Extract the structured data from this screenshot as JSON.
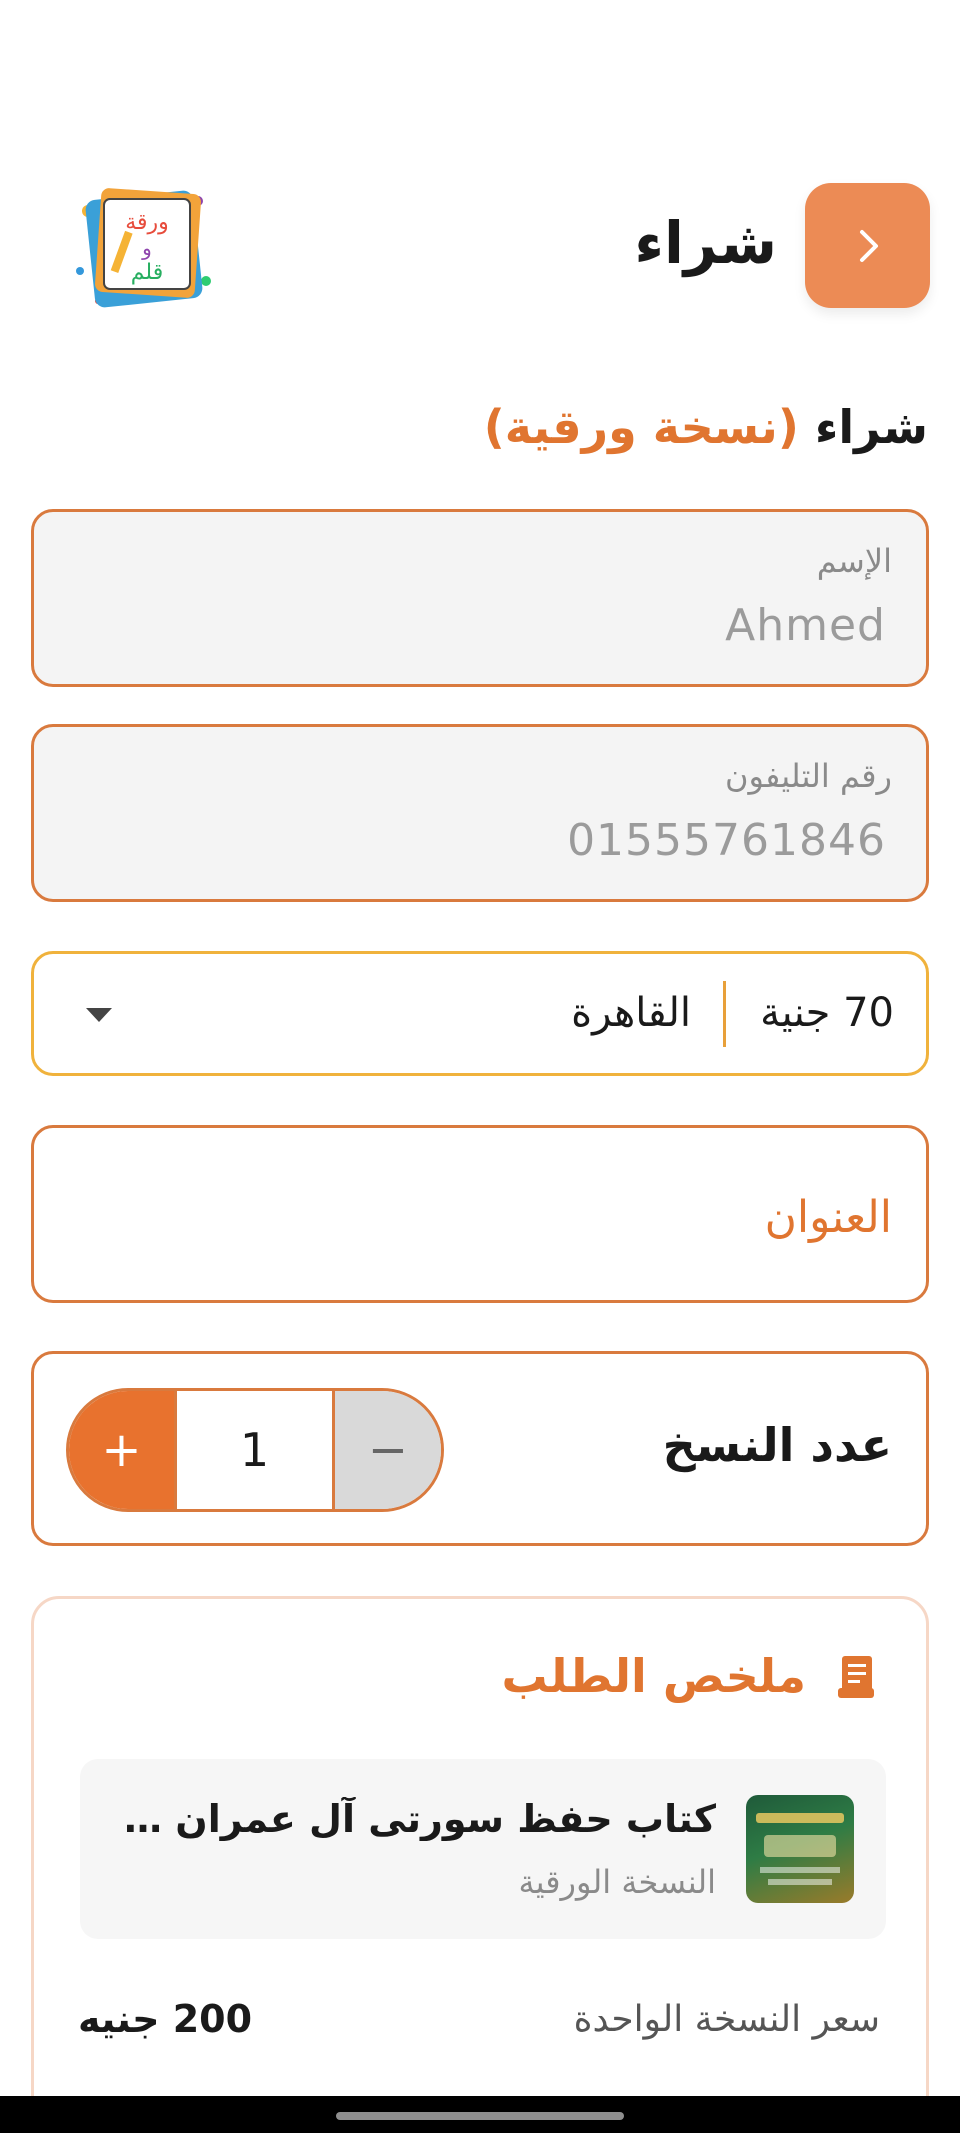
{
  "header": {
    "title": "شراء",
    "back_icon": "chevron-right-icon",
    "logo_text": "ورقة و قلم"
  },
  "section": {
    "title_main": "شراء",
    "title_highlight": "(نسخة ورقية)"
  },
  "form": {
    "name_label": "الإسم",
    "name_value": "Ahmed",
    "phone_label": "رقم التليفون",
    "phone_value": "01555761846",
    "shipping_price": "70 جنية",
    "city": "القاهرة",
    "address_label": "العنوان",
    "quantity_label": "عدد النسخ",
    "quantity_value": "1",
    "plus_label": "+",
    "minus_label": "−"
  },
  "summary": {
    "title": "ملخص الطلب",
    "icon": "receipt-icon",
    "item_name": "كتاب حفظ سورتى آل عمران والنساء",
    "item_type": "النسخة الورقية",
    "unit_price_label": "سعر النسخة الواحدة",
    "unit_price_value": "200 جنيه"
  },
  "colors": {
    "accent": "#e8722e",
    "back_button": "#ec8b55",
    "field_border": "#d97a3e",
    "select_border": "#f0b23c",
    "summary_border": "#f6d7c6"
  }
}
